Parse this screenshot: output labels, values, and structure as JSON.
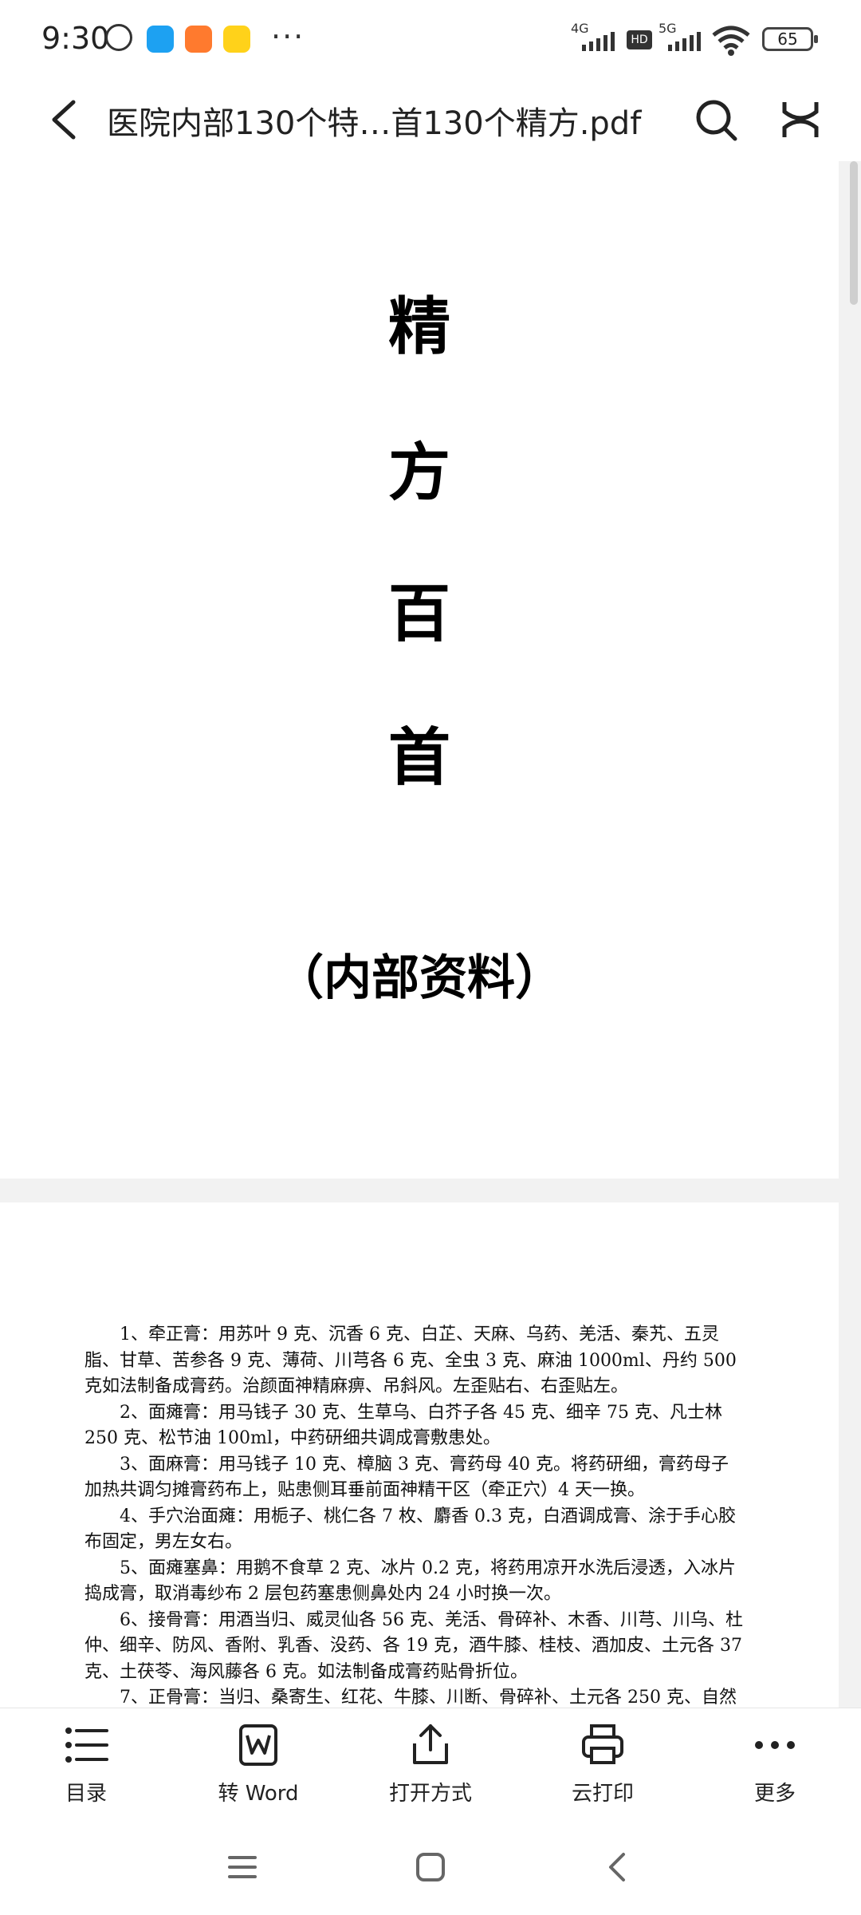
{
  "status_bar": {
    "time": "9:30",
    "signal_1": "4G",
    "signal_2": "5G",
    "hd": "HD",
    "battery": "65"
  },
  "toolbar": {
    "title": "医院内部130个特…首130个精方.pdf"
  },
  "document": {
    "cover": {
      "chars": [
        "精",
        "方",
        "百",
        "首"
      ],
      "subtitle": "（内部资料）"
    },
    "page2_paragraphs": [
      "1、牵正膏：用苏叶 9 克、沉香 6 克、白芷、天麻、乌药、羌活、秦艽、五灵脂、甘草、苦参各 9 克、薄荷、川芎各 6 克、全虫 3 克、麻油 1000ml、丹约 500 克如法制备成膏药。治颜面神精麻痹、吊斜风。左歪贴右、右歪贴左。",
      "2、面瘫膏：用马钱子 30 克、生草乌、白芥子各 45 克、细辛 75 克、凡士林 250 克、松节油 100ml，中药研细共调成膏敷患处。",
      "3、面麻膏：用马钱子 10 克、樟脑 3 克、膏药母 40 克。将药研细，膏药母子加热共调匀摊膏药布上，贴患侧耳垂前面神精干区（牵正穴）4 天一换。",
      "4、手穴治面瘫：用栀子、桃仁各 7 枚、麝香 0.3 克，白酒调成膏、涂于手心胶布固定，男左女右。",
      "5、面瘫塞鼻：用鹅不食草 2 克、冰片 0.2 克，将药用凉开水洗后浸透，入冰片捣成膏，取消毒纱布 2 层包药塞患侧鼻处内 24 小时换一次。",
      "6、接骨膏：用酒当归、威灵仙各 56 克、羌活、骨碎补、木香、川芎、川乌、杜仲、细辛、防风、香附、乳香、没药、各 19 克，酒牛膝、桂枝、酒加皮、土元各 37 克、土茯苓、海风藤各 6 克。如法制备成膏药贴骨折位。",
      "7、正骨膏：当归、桑寄生、红花、牛膝、川断、骨碎补、土元各 250 克、自然"
    ]
  },
  "actions": [
    {
      "label": "目录",
      "icon": "list-icon"
    },
    {
      "label": "转 Word",
      "icon": "word-icon"
    },
    {
      "label": "打开方式",
      "icon": "share-icon"
    },
    {
      "label": "云打印",
      "icon": "printer-icon"
    },
    {
      "label": "更多",
      "icon": "more-icon"
    }
  ]
}
